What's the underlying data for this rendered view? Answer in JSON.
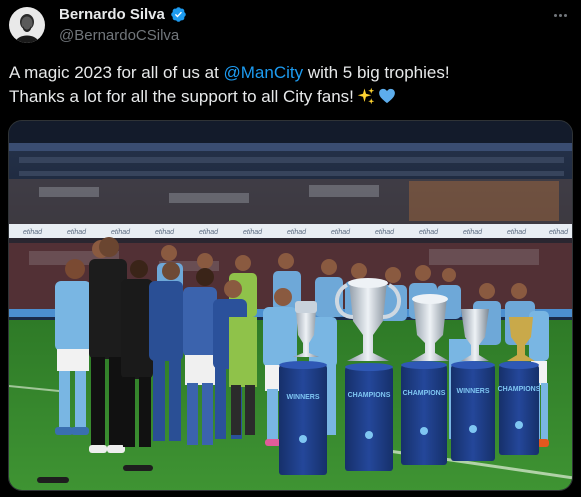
{
  "author": {
    "display_name": "Bernardo Silva",
    "handle": "@BernardoCSilva",
    "verified_icon": "verified-badge-icon",
    "verified_color": "#1d9bf0"
  },
  "tweet": {
    "line1_prefix": "A magic 2023 for all of us at ",
    "mention": "@ManCity",
    "line1_suffix": " with 5 big trophies!",
    "line2": "Thanks a lot for all the support to all City fans!",
    "emojis": [
      "sparkles-emoji",
      "blue-heart-emoji"
    ]
  },
  "media": {
    "alt_icon": "team-trophy-photo",
    "board_text": "etihad",
    "pedestal_labels": [
      "WINNERS",
      "CHAMPIONS",
      "CHAMPIONS",
      "WINNERS",
      "CHAMPIONS"
    ]
  },
  "colors": {
    "background": "#000000",
    "text": "#e7e9ea",
    "secondary": "#71767b",
    "link": "#1d9bf0",
    "pitch": "#3c8a2e",
    "kit": "#79b6e3",
    "pedestal": "#1c3a7a"
  }
}
